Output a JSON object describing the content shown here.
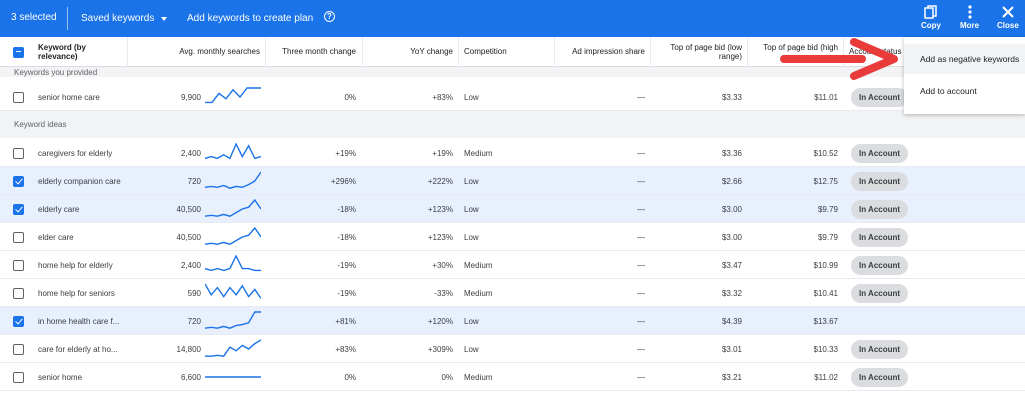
{
  "toolbar": {
    "selected_count": "3 selected",
    "saved_keywords": "Saved keywords",
    "add_keywords": "Add keywords to create plan",
    "help_glyph": "?",
    "copy": "Copy",
    "more": "More",
    "close": "Close",
    "bg_color": "#1a73e8"
  },
  "columns": {
    "keyword": "Keyword (by relevance)",
    "avg": "Avg. monthly searches",
    "three_month": "Three month change",
    "yoy": "YoY change",
    "competition": "Competition",
    "ad_share": "Ad impression share",
    "bid_low": "Top of page bid (low range)",
    "bid_high": "Top of page bid (high",
    "status": "Account status"
  },
  "sections": {
    "provided": "Keywords you provided",
    "ideas": "Keyword ideas"
  },
  "rows_provided": [
    {
      "checked": false,
      "keyword": "senior home care",
      "avg": "9,900",
      "three": "0%",
      "yoy": "+83%",
      "comp": "Low",
      "share": "—",
      "low": "$3.33",
      "high": "$11.01",
      "status": "In Account",
      "trend": [
        0.2,
        0.2,
        0.7,
        0.4,
        0.9,
        0.5,
        1,
        1,
        1
      ]
    }
  ],
  "rows_ideas": [
    {
      "checked": false,
      "keyword": "caregivers for elderly",
      "avg": "2,400",
      "three": "+19%",
      "yoy": "+19%",
      "comp": "Medium",
      "share": "—",
      "low": "$3.36",
      "high": "$10.52",
      "status": "In Account",
      "trend": [
        0.2,
        0.3,
        0.2,
        0.4,
        0.2,
        1,
        0.3,
        0.9,
        0.2,
        0.3
      ]
    },
    {
      "checked": true,
      "keyword": "elderly companion care",
      "avg": "720",
      "three": "+296%",
      "yoy": "+222%",
      "comp": "Low",
      "share": "—",
      "low": "$2.66",
      "high": "$12.75",
      "status": "In Account",
      "trend": [
        0.15,
        0.2,
        0.15,
        0.25,
        0.1,
        0.2,
        0.15,
        0.3,
        0.5,
        1
      ]
    },
    {
      "checked": true,
      "keyword": "elderly care",
      "avg": "40,500",
      "three": "-18%",
      "yoy": "+123%",
      "comp": "Low",
      "share": "—",
      "low": "$3.00",
      "high": "$9.79",
      "status": "In Account",
      "trend": [
        0.1,
        0.15,
        0.1,
        0.2,
        0.1,
        0.3,
        0.5,
        0.6,
        1,
        0.5
      ]
    },
    {
      "checked": false,
      "keyword": "elder care",
      "avg": "40,500",
      "three": "-18%",
      "yoy": "+123%",
      "comp": "Low",
      "share": "—",
      "low": "$3.00",
      "high": "$9.79",
      "status": "In Account",
      "trend": [
        0.1,
        0.15,
        0.1,
        0.2,
        0.1,
        0.3,
        0.5,
        0.6,
        1,
        0.5
      ]
    },
    {
      "checked": false,
      "keyword": "home help for elderly",
      "avg": "2,400",
      "three": "-19%",
      "yoy": "+30%",
      "comp": "Medium",
      "share": "—",
      "low": "$3.47",
      "high": "$10.99",
      "status": "In Account",
      "trend": [
        0.3,
        0.2,
        0.3,
        0.2,
        0.3,
        1,
        0.3,
        0.3,
        0.2,
        0.2
      ]
    },
    {
      "checked": false,
      "keyword": "home help for seniors",
      "avg": "590",
      "three": "-19%",
      "yoy": "-33%",
      "comp": "Medium",
      "share": "—",
      "low": "$3.32",
      "high": "$10.41",
      "status": "In Account",
      "trend": [
        1,
        0.4,
        0.8,
        0.3,
        0.8,
        0.4,
        0.9,
        0.3,
        0.7,
        0.2
      ]
    },
    {
      "checked": true,
      "keyword": "in home health care f...",
      "avg": "720",
      "three": "+81%",
      "yoy": "+120%",
      "comp": "Low",
      "share": "—",
      "low": "$4.39",
      "high": "$13.67",
      "status": "",
      "trend": [
        0.1,
        0.15,
        0.1,
        0.2,
        0.1,
        0.25,
        0.3,
        0.4,
        1,
        1
      ]
    },
    {
      "checked": false,
      "keyword": "care for elderly at ho...",
      "avg": "14,800",
      "three": "+83%",
      "yoy": "+309%",
      "comp": "Low",
      "share": "—",
      "low": "$3.01",
      "high": "$10.33",
      "status": "In Account",
      "trend": [
        0.1,
        0.1,
        0.15,
        0.1,
        0.6,
        0.4,
        0.7,
        0.5,
        0.8,
        1
      ]
    },
    {
      "checked": false,
      "keyword": "senior home",
      "avg": "6,600",
      "three": "0%",
      "yoy": "0%",
      "comp": "Medium",
      "share": "—",
      "low": "$3.21",
      "high": "$11.02",
      "status": "In Account",
      "trend": [
        0.5,
        0.5,
        0.5,
        0.5,
        0.5,
        0.5,
        0.5,
        0.5,
        0.5,
        0.5
      ]
    }
  ],
  "menu": {
    "add_negative": "Add as negative keywords",
    "add_account": "Add to account"
  },
  "colors": {
    "accent": "#1a73e8",
    "selected_row": "#e8f0fe",
    "section_bg": "#f1f3f4",
    "annotation_arrow": "#ea3b3b"
  }
}
